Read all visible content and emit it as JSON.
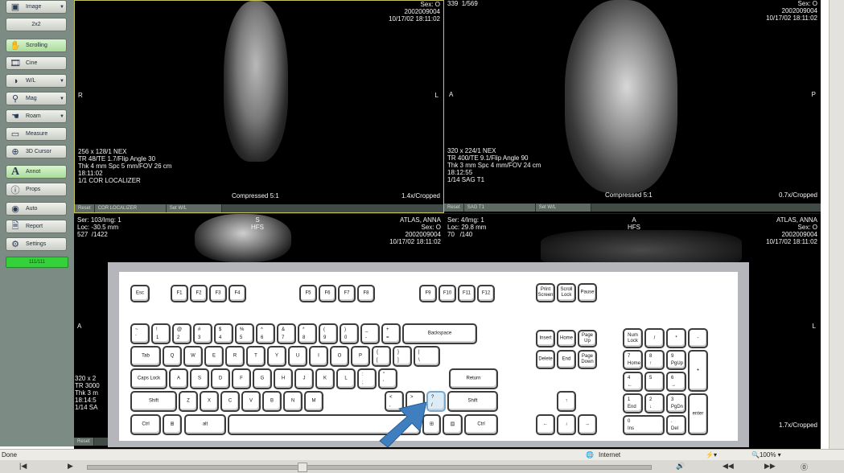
{
  "toolbar": {
    "image_btn": "Image",
    "layout_2x2": "2x2",
    "scrolling": "Scrolling",
    "cine": "Cine",
    "wl": "W/L",
    "mag": "Mag",
    "roam": "Roam",
    "measure": "Measure",
    "cursor3d": "3D Cursor",
    "annot": "Annot",
    "props": "Props",
    "auto": "Auto",
    "report": "Report",
    "settings": "Settings",
    "status": "111/111"
  },
  "viewports": {
    "v1": {
      "patient_right": "Sex: O\n2002009004\n10/17/02 18:11:02",
      "orient_left": "R",
      "orient_right": "L",
      "info": "256 x 128/1 NEX\nTR 48/TE 1.7/Flip Angle 30\nThk 4 mm Spc 5 mm/FOV 26 cm\n18:11:02\n1/1 COR LOCALIZER",
      "compression": "Compressed 5:1",
      "zoom": "1.4x/Cropped",
      "tabs": [
        "Reset",
        "COR LOCALIZER",
        "Set W/L"
      ]
    },
    "v2": {
      "top_left": "339  1/569",
      "patient_right": "Sex: O\n2002009004\n10/17/02 18:11:02",
      "orient_left": "A",
      "orient_right": "P",
      "info": "320 x 224/1 NEX\nTR 400/TE 9.1/Flip Angle 90\nThk 3 mm Spc 4 mm/FOV 24 cm\n18:12:55\n1/14 SAG T1",
      "compression": "Compressed 5:1",
      "zoom": "0.7x/Cropped",
      "tabs": [
        "Reset",
        "SAG T1",
        "Set W/L"
      ]
    },
    "v3": {
      "ser": "Ser: 103/Img: 1\nLoc: -30.5 mm\n527  /1422",
      "top_center": "S\nHFS",
      "patient_right": "ATLAS, ANNA\nSex: O\n2002009004\n10/17/02 18:11:02",
      "orient_left": "A",
      "info": "320 x 2\nTR 3000\nThk 3 m\n18:14:5\n1/14 SA",
      "tabs": [
        "Reset"
      ]
    },
    "v4": {
      "ser": "Ser: 4/Img: 1\nLoc: 29.8 mm\n70   /140",
      "top_center": "A\nHFS",
      "patient_right": "ATLAS, ANNA\nSex: O\n2002009004\n10/17/02 18:11:02",
      "orient_right": "L",
      "zoom": "1.7x/Cropped"
    }
  },
  "keyboard": {
    "esc": "Esc",
    "f_keys": [
      "F1",
      "F2",
      "F3",
      "F4",
      "F5",
      "F6",
      "F7",
      "F8",
      "F9",
      "F10",
      "F11",
      "F12"
    ],
    "print_screen": "Print\nScreen",
    "scroll_lock": "Scroll\nLock",
    "pause": "Pause",
    "backspace": "Backspace",
    "tab": "Tab",
    "caps_lock": "Caps Lock",
    "ret": "Return",
    "shift": "Shift",
    "ctrl": "Ctrl",
    "alt": "alt",
    "insert": "Insert",
    "home": "Home",
    "page_up": "Page\nUp",
    "delete": "Delete",
    "end": "End",
    "page_down": "Page\nDown",
    "num_lock": "Num\nLock",
    "enter": "enter",
    "num_home": "Home",
    "num_pgup": "PgUp",
    "num_end": "End",
    "num_pgdn": "PgDn",
    "ins": "Ins",
    "del": "Del",
    "row_digits": [
      [
        "~",
        "`"
      ],
      [
        "!",
        "1"
      ],
      [
        "@",
        "2"
      ],
      [
        "#",
        "3"
      ],
      [
        "$",
        "4"
      ],
      [
        "%",
        "5"
      ],
      [
        "^",
        "6"
      ],
      [
        "&",
        "7"
      ],
      [
        "*",
        "8"
      ],
      [
        "(",
        "9"
      ],
      [
        ")",
        "0"
      ],
      [
        "_",
        "-"
      ],
      [
        "+",
        "="
      ]
    ],
    "row_q": [
      "Q",
      "W",
      "E",
      "R",
      "T",
      "Y",
      "U",
      "I",
      "O",
      "P"
    ],
    "row_q_extra": [
      [
        "{",
        "["
      ],
      [
        "}",
        "]"
      ],
      [
        "|",
        "\\"
      ]
    ],
    "row_a": [
      "A",
      "S",
      "D",
      "F",
      "G",
      "H",
      "J",
      "K",
      "L"
    ],
    "row_a_extra": [
      [
        ":",
        ";"
      ],
      [
        "\"",
        "'"
      ]
    ],
    "row_z": [
      "Z",
      "X",
      "C",
      "V",
      "B",
      "N",
      "M"
    ],
    "row_z_extra": [
      [
        "<",
        ","
      ],
      [
        ">",
        "."
      ],
      [
        "?",
        "/"
      ]
    ],
    "num_ops": [
      "/",
      "*",
      "-",
      "+"
    ],
    "num_digits": [
      "7",
      "8",
      "9",
      "4",
      "5",
      "6",
      "1",
      "2",
      "3",
      "0",
      "."
    ]
  },
  "browser": {
    "status_left": "Done",
    "zone": "Internet",
    "zoom": "100%"
  }
}
